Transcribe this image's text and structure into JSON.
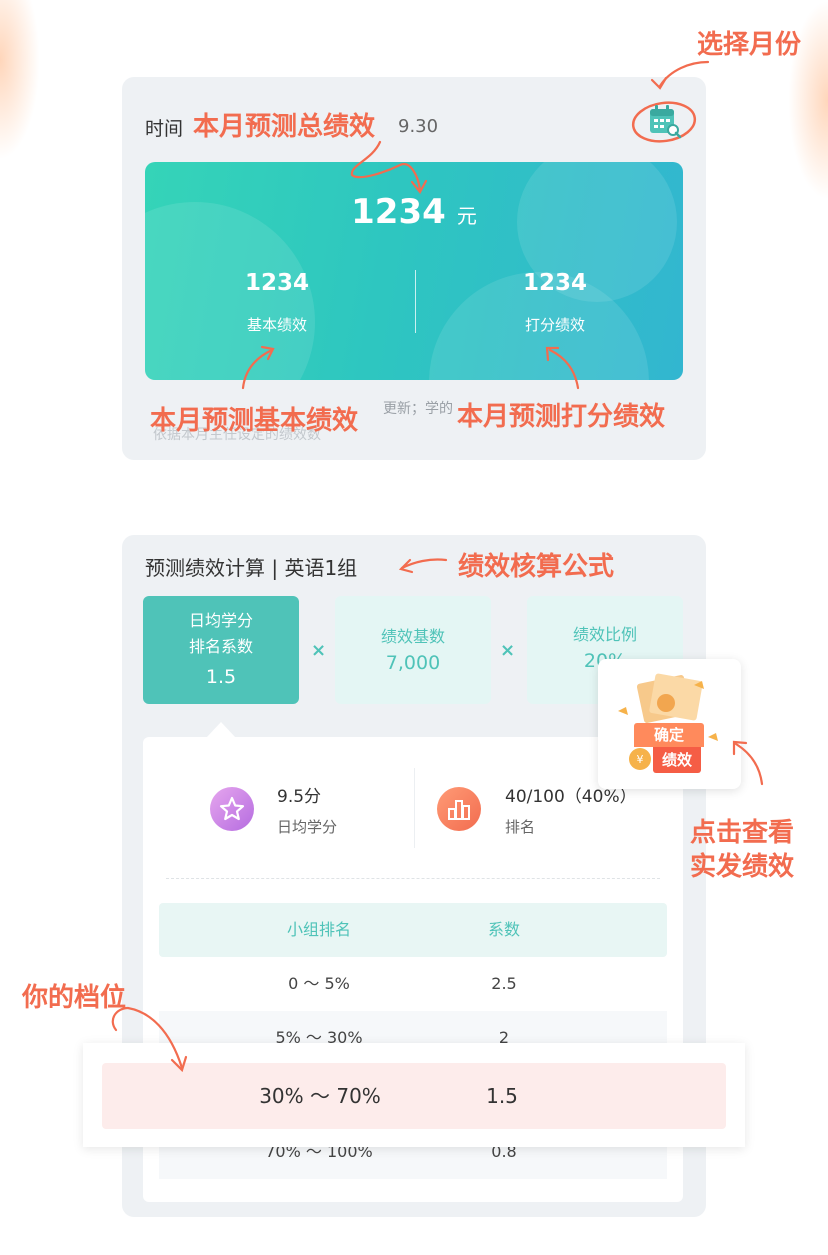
{
  "colors": {
    "accent": "#f26c4f",
    "teal": "#4fc3b8",
    "hero_start": "#35d4b8",
    "hero_end": "#32b6d0",
    "highlight_row": "#fdeceb"
  },
  "top_card": {
    "time_label": "时间",
    "date_fragment": "9.30",
    "calendar_icon": "calendar-search-icon",
    "total_value": "1234",
    "total_unit": "元",
    "basic": {
      "value": "1234",
      "label": "基本绩效"
    },
    "scored": {
      "value": "1234",
      "label": "打分绩效"
    },
    "note_fragment": "更新；学的",
    "note_line2": "依据本月主任设定的绩效数"
  },
  "annotations": {
    "select_month": "选择月份",
    "total": "本月预测总绩效",
    "basic": "本月预测基本绩效",
    "scored": "本月预测打分绩效",
    "formula": "绩效核算公式",
    "click_view_l1": "点击查看",
    "click_view_l2": "实发绩效",
    "your_tier": "你的档位"
  },
  "calc_card": {
    "title": "预测绩效计算 | 英语1组",
    "formula": [
      {
        "line1": "日均学分",
        "line2": "排名系数",
        "value": "1.5"
      },
      {
        "line1": "绩效基数",
        "line2": "",
        "value": "7,000"
      },
      {
        "line1": "绩效比例",
        "line2": "",
        "value": "20%"
      }
    ],
    "times_symbol": "×",
    "stats": {
      "credit_value": "9.5分",
      "credit_label": "日均学分",
      "rank_value": "40/100（40%）",
      "rank_label": "排名"
    },
    "table": {
      "headers": [
        "小组排名",
        "系数"
      ],
      "rows": [
        {
          "range": "0 ～ 5%",
          "coef": "2.5"
        },
        {
          "range": "5% ～ 30%",
          "coef": "2"
        },
        {
          "range": "30% ～ 70%",
          "coef": "1.5"
        },
        {
          "range": "70% ～ 100%",
          "coef": "0.8"
        }
      ]
    },
    "confirm_badge": {
      "line1": "确定",
      "line2": "绩效"
    }
  }
}
